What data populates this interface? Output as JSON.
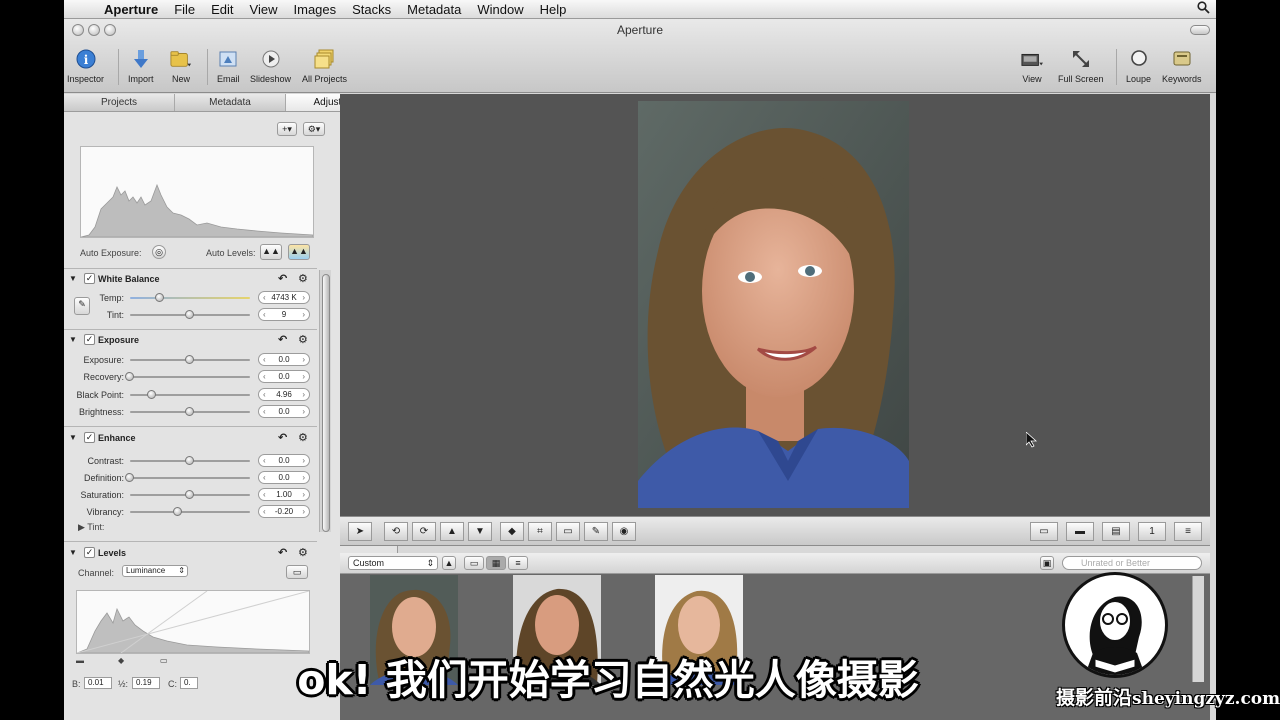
{
  "menubar": {
    "app_name": "Aperture",
    "items": [
      "File",
      "Edit",
      "View",
      "Images",
      "Stacks",
      "Metadata",
      "Window",
      "Help"
    ]
  },
  "window": {
    "title": "Aperture"
  },
  "toolbar": {
    "inspector": "Inspector",
    "import": "Import",
    "new": "New",
    "email": "Email",
    "slideshow": "Slideshow",
    "all_projects": "All Projects",
    "view": "View",
    "full_screen": "Full Screen",
    "loupe": "Loupe",
    "keywords": "Keywords"
  },
  "tabs": [
    "Projects",
    "Metadata",
    "Adjustments"
  ],
  "auto_exposure_label": "Auto Exposure:",
  "auto_levels_label": "Auto Levels:",
  "white_balance": {
    "title": "White Balance",
    "temp": {
      "label": "Temp:",
      "value": "4743 K",
      "position": 0.25
    },
    "tint": {
      "label": "Tint:",
      "value": "9",
      "position": 0.5
    }
  },
  "exposure": {
    "title": "Exposure",
    "rows": [
      {
        "label": "Exposure:",
        "value": "0.0",
        "position": 0.5
      },
      {
        "label": "Recovery:",
        "value": "0.0",
        "position": 0.0
      },
      {
        "label": "Black Point:",
        "value": "4.96",
        "position": 0.18
      },
      {
        "label": "Brightness:",
        "value": "0.0",
        "position": 0.5
      }
    ]
  },
  "enhance": {
    "title": "Enhance",
    "rows": [
      {
        "label": "Contrast:",
        "value": "0.0",
        "position": 0.5
      },
      {
        "label": "Definition:",
        "value": "0.0",
        "position": 0.0
      },
      {
        "label": "Saturation:",
        "value": "1.00",
        "position": 0.5
      },
      {
        "label": "Vibrancy:",
        "value": "-0.20",
        "position": 0.4
      }
    ],
    "tint_label": "Tint:"
  },
  "levels": {
    "title": "Levels",
    "channel_label": "Channel:",
    "channel_value": "Luminance",
    "b_label": "B:",
    "b_value": "0.01",
    "half_label": "½:",
    "half_value": "0.19",
    "c_label": "C:",
    "c_value": "0."
  },
  "browser": {
    "sort_value": "Custom",
    "search_placeholder": "Unrated or Better"
  },
  "overlay": {
    "subtitle": "ok! 我们开始学习自然光人像摄影",
    "watermark_cn": "摄影前沿",
    "watermark_url": "sheyingzyz.com"
  },
  "colors": {
    "viewer_bg": "#545454",
    "shirt_blue": "#3e5aa8",
    "hair_brown": "#6a5232"
  }
}
